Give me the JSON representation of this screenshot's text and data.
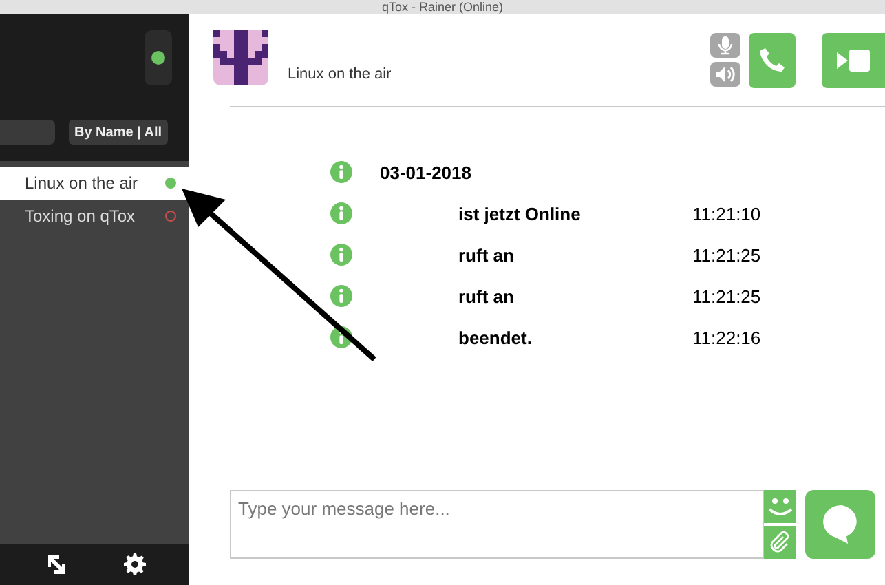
{
  "window": {
    "title": "qTox - Rainer (Online)"
  },
  "sidebar": {
    "online": true,
    "filter_button": "By Name | All",
    "contacts": [
      {
        "name": "Linux on the air",
        "selected": true,
        "online": true
      },
      {
        "name": "Toxing on qTox",
        "selected": false,
        "online": false
      }
    ]
  },
  "header": {
    "name": "Linux on the air"
  },
  "messages": [
    {
      "kind": "date",
      "text": "03-01-2018"
    },
    {
      "kind": "info",
      "text": "ist jetzt Online",
      "time": "11:21:10"
    },
    {
      "kind": "info",
      "text": "ruft an",
      "time": "11:21:25"
    },
    {
      "kind": "info",
      "text": "ruft an",
      "time": "11:21:25"
    },
    {
      "kind": "info",
      "text": "beendet.",
      "time": "11:22:16"
    }
  ],
  "composer": {
    "placeholder": "Type your message here..."
  }
}
